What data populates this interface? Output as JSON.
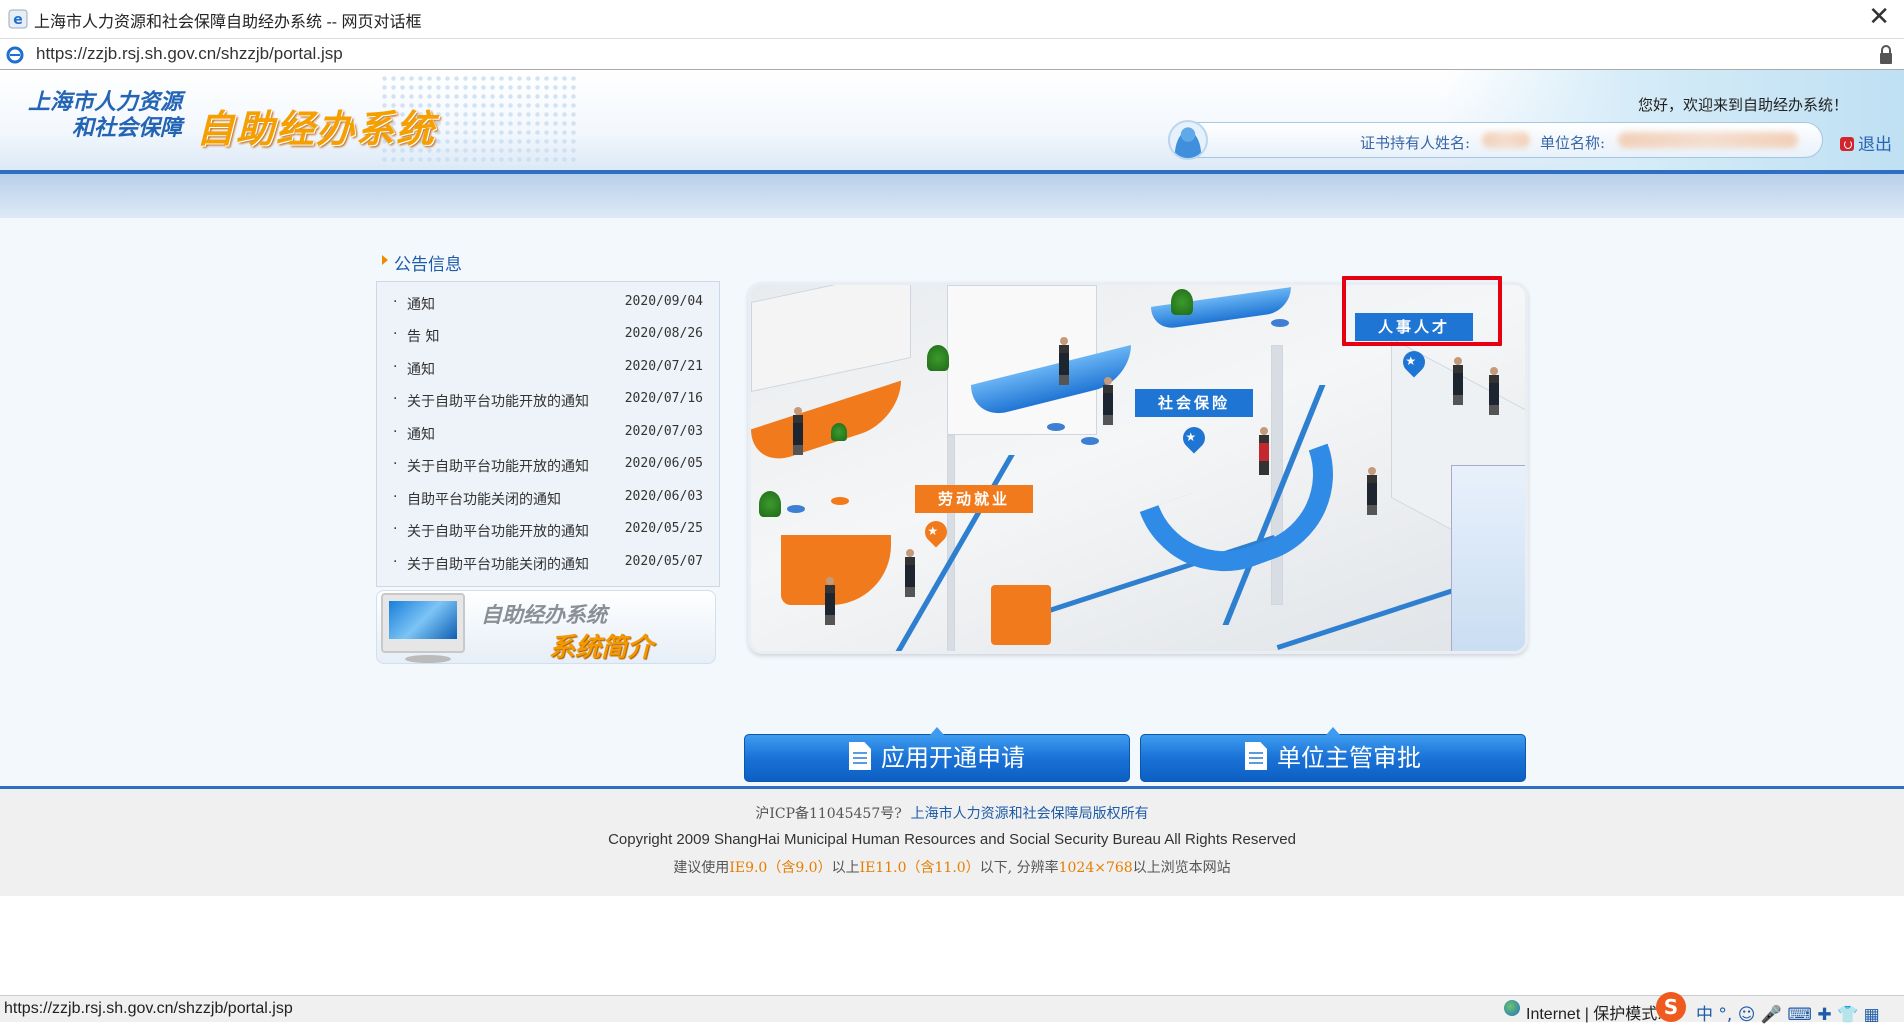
{
  "window": {
    "title": "上海市人力资源和社会保障自助经办系统 -- 网页对话框",
    "close_label": "✕",
    "url": "https://zzjb.rsj.sh.gov.cn/shzzjb/portal.jsp"
  },
  "header": {
    "logo_line1": "上海市人力资源",
    "logo_line2": "和社会保障",
    "logo_system": "自助经办系统",
    "welcome": "您好，欢迎来到自助经办系统！",
    "holder_label": "证书持有人姓名:",
    "unit_label": "单位名称:",
    "logout_label": "退出"
  },
  "announcements": {
    "title": "公告信息",
    "items": [
      {
        "title": "通知",
        "date": "2020/09/04"
      },
      {
        "title": "告 知",
        "date": "2020/08/26"
      },
      {
        "title": "通知",
        "date": "2020/07/21"
      },
      {
        "title": "关于自助平台功能开放的通知",
        "date": "2020/07/16"
      },
      {
        "title": "通知",
        "date": "2020/07/03"
      },
      {
        "title": "关于自助平台功能开放的通知",
        "date": "2020/06/05"
      },
      {
        "title": "自助平台功能关闭的通知",
        "date": "2020/06/03"
      },
      {
        "title": "关于自助平台功能开放的通知",
        "date": "2020/05/25"
      },
      {
        "title": "关于自助平台功能关闭的通知",
        "date": "2020/05/07"
      }
    ]
  },
  "intro": {
    "line1": "自助经办系统",
    "line2": "系统简介"
  },
  "hall": {
    "sign_labour": "劳动就业",
    "sign_social": "社会保险",
    "sign_talent": "人事人才"
  },
  "buttons": {
    "apply": "应用开通申请",
    "approve": "单位主管审批"
  },
  "footer": {
    "icp": "沪ICP备11045457号?",
    "copyright_org": "上海市人力资源和社会保障局版权所有",
    "copyright_en": "Copyright 2009 ShangHai Municipal Human Resources and Social Security Bureau All Rights Reserved",
    "browser_prefix": "建议使用",
    "ie9": "IE9.0（含9.0）",
    "mid1": "以上",
    "ie11": "IE11.0（含11.0）",
    "mid2": "以下, 分辨率",
    "resolution": "1024×768",
    "suffix": "以上浏览本网站"
  },
  "statusbar": {
    "url": "https://zzjb.rsj.sh.gov.cn/shzzjb/portal.jsp",
    "zone": "Internet | 保护模式: ",
    "ime_logo": "S",
    "ime_items": "中 °, ☺ 🎤 ⌨ ✚ 👕 ▦"
  },
  "colors": {
    "brand_blue": "#2f6fc2",
    "accent_orange": "#f39800",
    "highlight_red": "#e60012"
  }
}
